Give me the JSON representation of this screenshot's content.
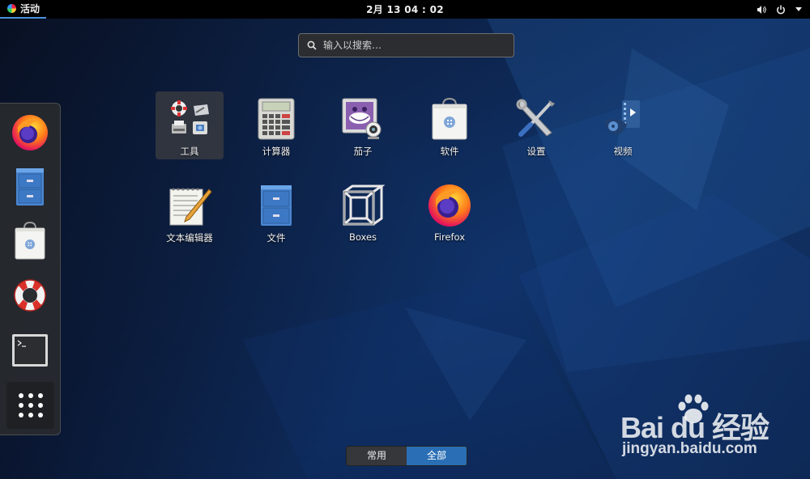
{
  "topbar": {
    "activities_label": "活动",
    "clock": "2月 13  04 : 02",
    "icons": [
      "volume-icon",
      "power-icon"
    ]
  },
  "search": {
    "placeholder": "输入以搜索…",
    "value": ""
  },
  "dock": {
    "items": [
      "firefox-icon",
      "files-icon",
      "software-icon",
      "help-icon",
      "terminal-icon",
      "show-apps-icon"
    ]
  },
  "apps": [
    {
      "label": "工具",
      "icon": "utilities-folder-icon"
    },
    {
      "label": "计算器",
      "icon": "calculator-icon"
    },
    {
      "label": "茄子",
      "icon": "cheese-icon"
    },
    {
      "label": "软件",
      "icon": "software-icon"
    },
    {
      "label": "设置",
      "icon": "settings-icon"
    },
    {
      "label": "视频",
      "icon": "videos-icon"
    },
    {
      "label": "文本编辑器",
      "icon": "text-editor-icon"
    },
    {
      "label": "文件",
      "icon": "files-icon"
    },
    {
      "label": "Boxes",
      "icon": "boxes-icon"
    },
    {
      "label": "Firefox",
      "icon": "firefox-icon"
    }
  ],
  "view_switch": {
    "frequent_label": "常用",
    "all_label": "全部",
    "selected": "全部"
  },
  "watermark": {
    "brand": "Bai du 经验",
    "url": "jingyan.baidu.com"
  },
  "colors": {
    "accent": "#2a6fb5",
    "topbar": "#000000",
    "dock": "#28292d"
  }
}
